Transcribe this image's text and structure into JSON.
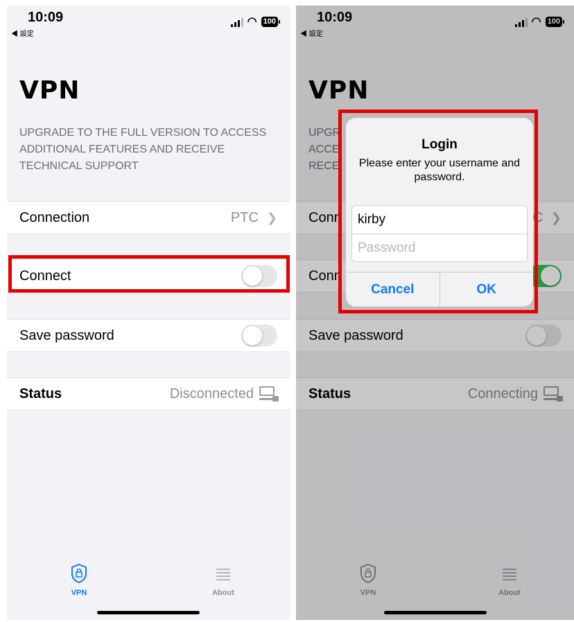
{
  "left": {
    "status": {
      "time": "10:09",
      "back": "◀ 設定",
      "battery": "100"
    },
    "title": "VPN",
    "subtitle": "UPGRADE TO THE FULL VERSION TO ACCESS ADDITIONAL FEATURES AND RECEIVE TECHNICAL SUPPORT",
    "connection": {
      "label": "Connection",
      "value": "PTC"
    },
    "connect": {
      "label": "Connect",
      "on": false
    },
    "save_password": {
      "label": "Save password",
      "on": false
    },
    "status_row": {
      "label": "Status",
      "value": "Disconnected"
    },
    "tabs": {
      "vpn": "VPN",
      "about": "About"
    }
  },
  "right": {
    "status": {
      "time": "10:09",
      "back": "◀ 設定",
      "battery": "100"
    },
    "title": "VPN",
    "subtitle_partial": [
      "UPGR",
      "ACCE",
      "RECE"
    ],
    "connection": {
      "label": "Conn",
      "value": "TC"
    },
    "connect": {
      "label": "Conn",
      "on": true
    },
    "save_password": {
      "label": "Save password",
      "on": false
    },
    "status_row": {
      "label": "Status",
      "value": "Connecting"
    },
    "tabs": {
      "vpn": "VPN",
      "about": "About"
    },
    "dialog": {
      "title": "Login",
      "message": "Please enter your username and password.",
      "username_value": "kirby",
      "password_placeholder": "Password",
      "cancel_label": "Cancel",
      "ok_label": "OK"
    }
  },
  "colors": {
    "highlight": "#e60000",
    "accent": "#0a7aff",
    "toggle_on": "#34c759"
  }
}
